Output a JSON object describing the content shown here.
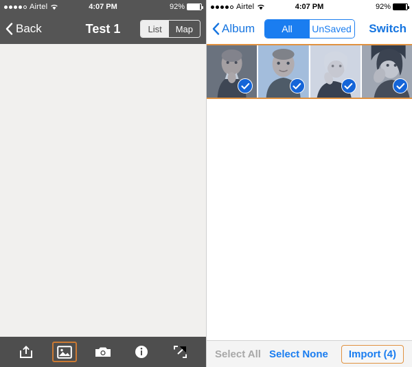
{
  "left_screen": {
    "status_bar": {
      "signal_dots_filled": 4,
      "signal_dots_total": 5,
      "carrier": "Airtel",
      "wifi_icon": "wifi-icon",
      "time": "4:07 PM",
      "battery_percent": "92%",
      "battery_level": 92
    },
    "nav_bar": {
      "back_icon": "chevron-left-icon",
      "back_label": "Back",
      "title": "Test 1",
      "segmented": {
        "options": [
          "List",
          "Map"
        ],
        "selected": "Map"
      }
    },
    "content": {
      "background_color": "#f1f0ee",
      "empty": true
    },
    "toolbar": {
      "background_color": "#4e4e4e",
      "active_index": 1,
      "items": [
        {
          "name": "share-icon",
          "label": "Share"
        },
        {
          "name": "photo-icon",
          "label": "Photos"
        },
        {
          "name": "camera-icon",
          "label": "Camera"
        },
        {
          "name": "info-icon",
          "label": "Info"
        },
        {
          "name": "expand-icon",
          "label": "Expand"
        }
      ]
    }
  },
  "right_screen": {
    "status_bar": {
      "signal_dots_filled": 4,
      "signal_dots_total": 5,
      "carrier": "Airtel",
      "wifi_icon": "wifi-icon",
      "time": "4:07 PM",
      "battery_percent": "92%",
      "battery_level": 92
    },
    "nav_bar": {
      "back_icon": "chevron-left-icon",
      "back_label": "Album",
      "segmented": {
        "options": [
          "All",
          "UnSaved"
        ],
        "selected": "All"
      },
      "switch_label": "Switch"
    },
    "thumbnails": {
      "border_color": "#e0913f",
      "items": [
        {
          "alt": "photo-1",
          "selected": true
        },
        {
          "alt": "photo-2",
          "selected": true
        },
        {
          "alt": "photo-3",
          "selected": true
        },
        {
          "alt": "photo-4",
          "selected": true
        }
      ]
    },
    "toolbar": {
      "select_all_label": "Select All",
      "select_all_enabled": false,
      "select_none_label": "Select None",
      "select_none_enabled": true,
      "import_label": "Import (4)",
      "import_border_color": "#e0913f"
    }
  },
  "colors": {
    "dark_chrome": "#555555",
    "toolbar_dark": "#4e4e4e",
    "accent_blue": "#1a7df0",
    "accent_orange": "#e0913f",
    "light_gray_bg": "#f1f0ee"
  }
}
